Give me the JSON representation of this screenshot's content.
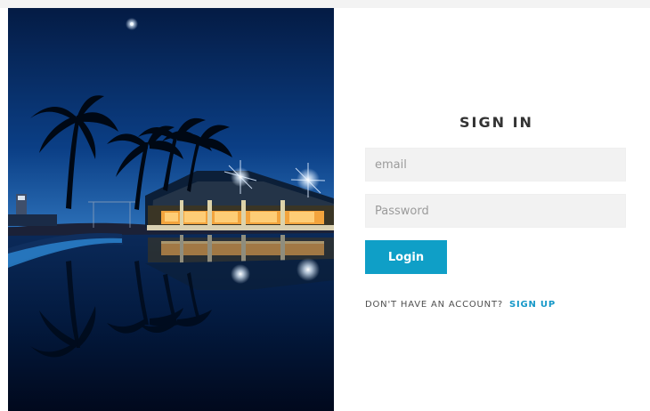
{
  "login": {
    "title": "SIGN IN",
    "email_placeholder": "email",
    "password_placeholder": "Password",
    "button_label": "Login",
    "signup_prompt": "DON'T HAVE AN ACCOUNT?",
    "signup_link": "SIGN UP"
  },
  "colors": {
    "accent": "#0f9fc7",
    "link": "#1698c8",
    "field_background": "#f2f2f2",
    "title_text": "#333333"
  },
  "hero_image": {
    "icon": "night-resort-palm-trees-photo"
  }
}
